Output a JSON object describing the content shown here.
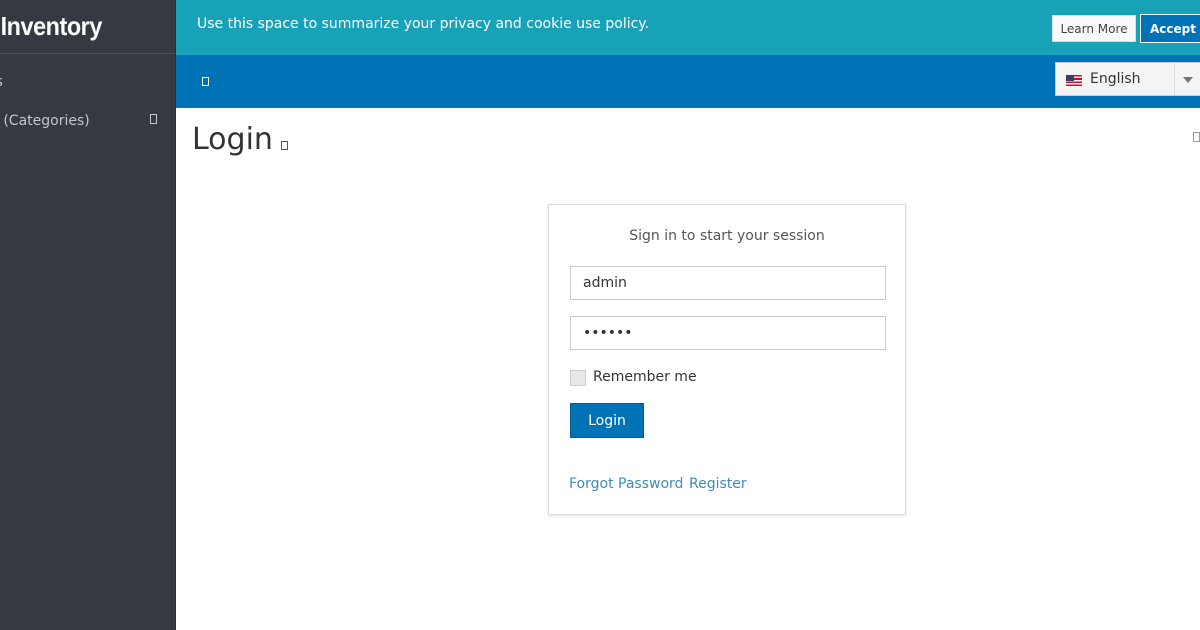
{
  "sidebar": {
    "brand": "k Inventory",
    "items": [
      {
        "label": "ws"
      },
      {
        "label": "p (Categories)"
      }
    ]
  },
  "cookie": {
    "message": "Use this space to summarize your privacy and cookie use policy.",
    "learn_more": "Learn More",
    "accept": "Accept"
  },
  "topnav": {
    "language": "English"
  },
  "page": {
    "title": "Login"
  },
  "login": {
    "message": "Sign in to start your session",
    "username_value": "admin",
    "password_value": "••••••",
    "remember_label": "Remember me",
    "login_button": "Login",
    "forgot_link": "Forgot Password",
    "register_link": "Register"
  },
  "colors": {
    "sidebar_bg": "#343a40",
    "cookie_bg": "#17a2b8",
    "primary": "#0073b7",
    "link": "#3c8dbc"
  }
}
